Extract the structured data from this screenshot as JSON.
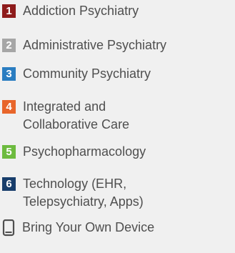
{
  "legend": {
    "items": [
      {
        "number": "1",
        "color": "#8e1b1b",
        "label_lines": [
          "Addiction Psychiatry"
        ]
      },
      {
        "number": "2",
        "color": "#a6a6a6",
        "label_lines": [
          "Administrative Psychiatry"
        ]
      },
      {
        "number": "3",
        "color": "#2a7dc1",
        "label_lines": [
          "Community Psychiatry"
        ]
      },
      {
        "number": "4",
        "color": "#e8652a",
        "label_lines": [
          "Integrated and",
          "Collaborative Care"
        ]
      },
      {
        "number": "5",
        "color": "#6dbb3f",
        "label_lines": [
          "Psychopharmacology"
        ]
      },
      {
        "number": "6",
        "color": "#173d6b",
        "label_lines": [
          "Technology (EHR,",
          "Telepsychiatry, Apps)"
        ]
      }
    ],
    "device_item": {
      "icon": "mobile-phone-icon",
      "label": "Bring Your Own Device"
    }
  }
}
